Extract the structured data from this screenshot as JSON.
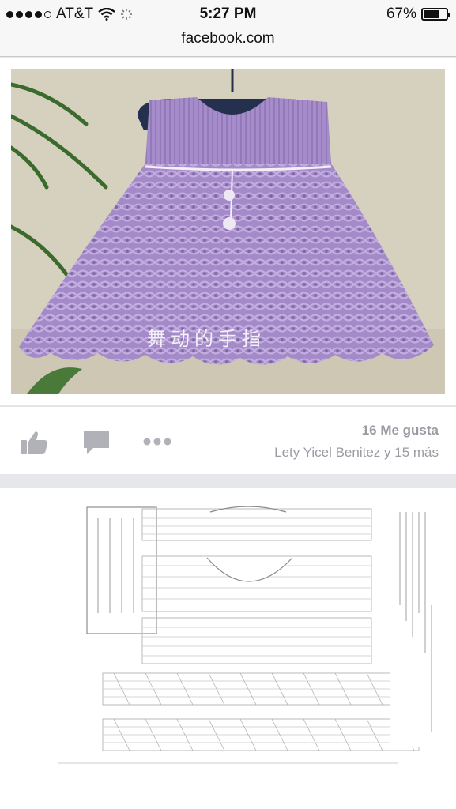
{
  "status_bar": {
    "carrier": "AT&T",
    "time": "5:27 PM",
    "battery": "67%",
    "battery_level": 0.67
  },
  "browser": {
    "url": "facebook.com"
  },
  "post": {
    "photo_watermark": "舞动的手指",
    "likes": "16 Me gusta",
    "liked_by": "Lety Yicel Benitez y 15 más"
  },
  "icons": {
    "like": "thumbs-up-icon",
    "comment": "comment-icon",
    "more": "more-dots-icon"
  },
  "colors": {
    "dress": "#a48ac8",
    "action_gray": "#9a9ca3"
  }
}
